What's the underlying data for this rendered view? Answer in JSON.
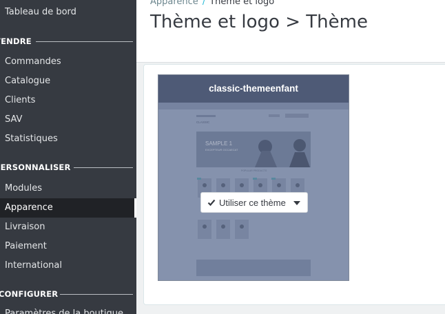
{
  "sidebar": {
    "items_top": [
      {
        "label": "Tableau de bord"
      }
    ],
    "sections": [
      {
        "title": "VENDRE",
        "items": [
          "Commandes",
          "Catalogue",
          "Clients",
          "SAV",
          "Statistiques"
        ]
      },
      {
        "title": "PERSONNALISER",
        "items": [
          "Modules",
          "Apparence",
          "Livraison",
          "Paiement",
          "International"
        ]
      },
      {
        "title": "CONFIGURER",
        "items": [
          "Paramètres de la boutique"
        ]
      }
    ],
    "active": "Apparence"
  },
  "header": {
    "breadcrumb": [
      "Apparence",
      "Thème et logo"
    ],
    "breadcrumb_sep": "/",
    "title": "Thème et logo > Thème"
  },
  "theme_card": {
    "name": "classic-themeenfant",
    "preview_banner": "SAMPLE 1",
    "preview_banner_sub": "EXCEPTEUR OCCAECAT",
    "preview_brand": "CLASSIC",
    "preview_section": "POPULAR PRODUCTS",
    "action_label": "Utiliser ce thème"
  },
  "colors": {
    "sidebar_bg": "#363a41",
    "card_header": "#4e5a76",
    "accent": "#25b9d7"
  }
}
